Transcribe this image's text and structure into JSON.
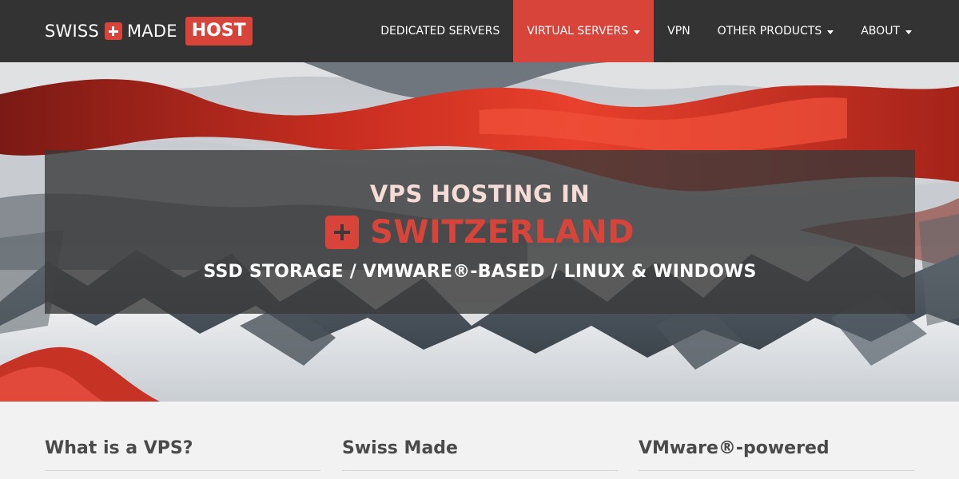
{
  "brand": {
    "word1": "SWISS",
    "word2": "MADE",
    "word3": "HOST",
    "accent_color": "#d9443a",
    "cross_icon": "swiss-cross-icon"
  },
  "nav": {
    "items": [
      {
        "label": "DEDICATED SERVERS",
        "dropdown": false,
        "active": false
      },
      {
        "label": "VIRTUAL SERVERS",
        "dropdown": true,
        "active": true
      },
      {
        "label": "VPN",
        "dropdown": false,
        "active": false
      },
      {
        "label": "OTHER PRODUCTS",
        "dropdown": true,
        "active": false
      },
      {
        "label": "ABOUT",
        "dropdown": true,
        "active": false
      }
    ],
    "dropdown_icon": "caret-down-icon",
    "background_color": "#333333"
  },
  "hero": {
    "line1": "VPS HOSTING IN",
    "country": "SWITZERLAND",
    "tagline": "SSD STORAGE / VMWARE®-BASED / LINUX & WINDOWS",
    "cross_icon": "swiss-cross-icon"
  },
  "features": [
    {
      "title": "What is a VPS?"
    },
    {
      "title": "Swiss Made"
    },
    {
      "title": "VMware®-powered"
    }
  ]
}
